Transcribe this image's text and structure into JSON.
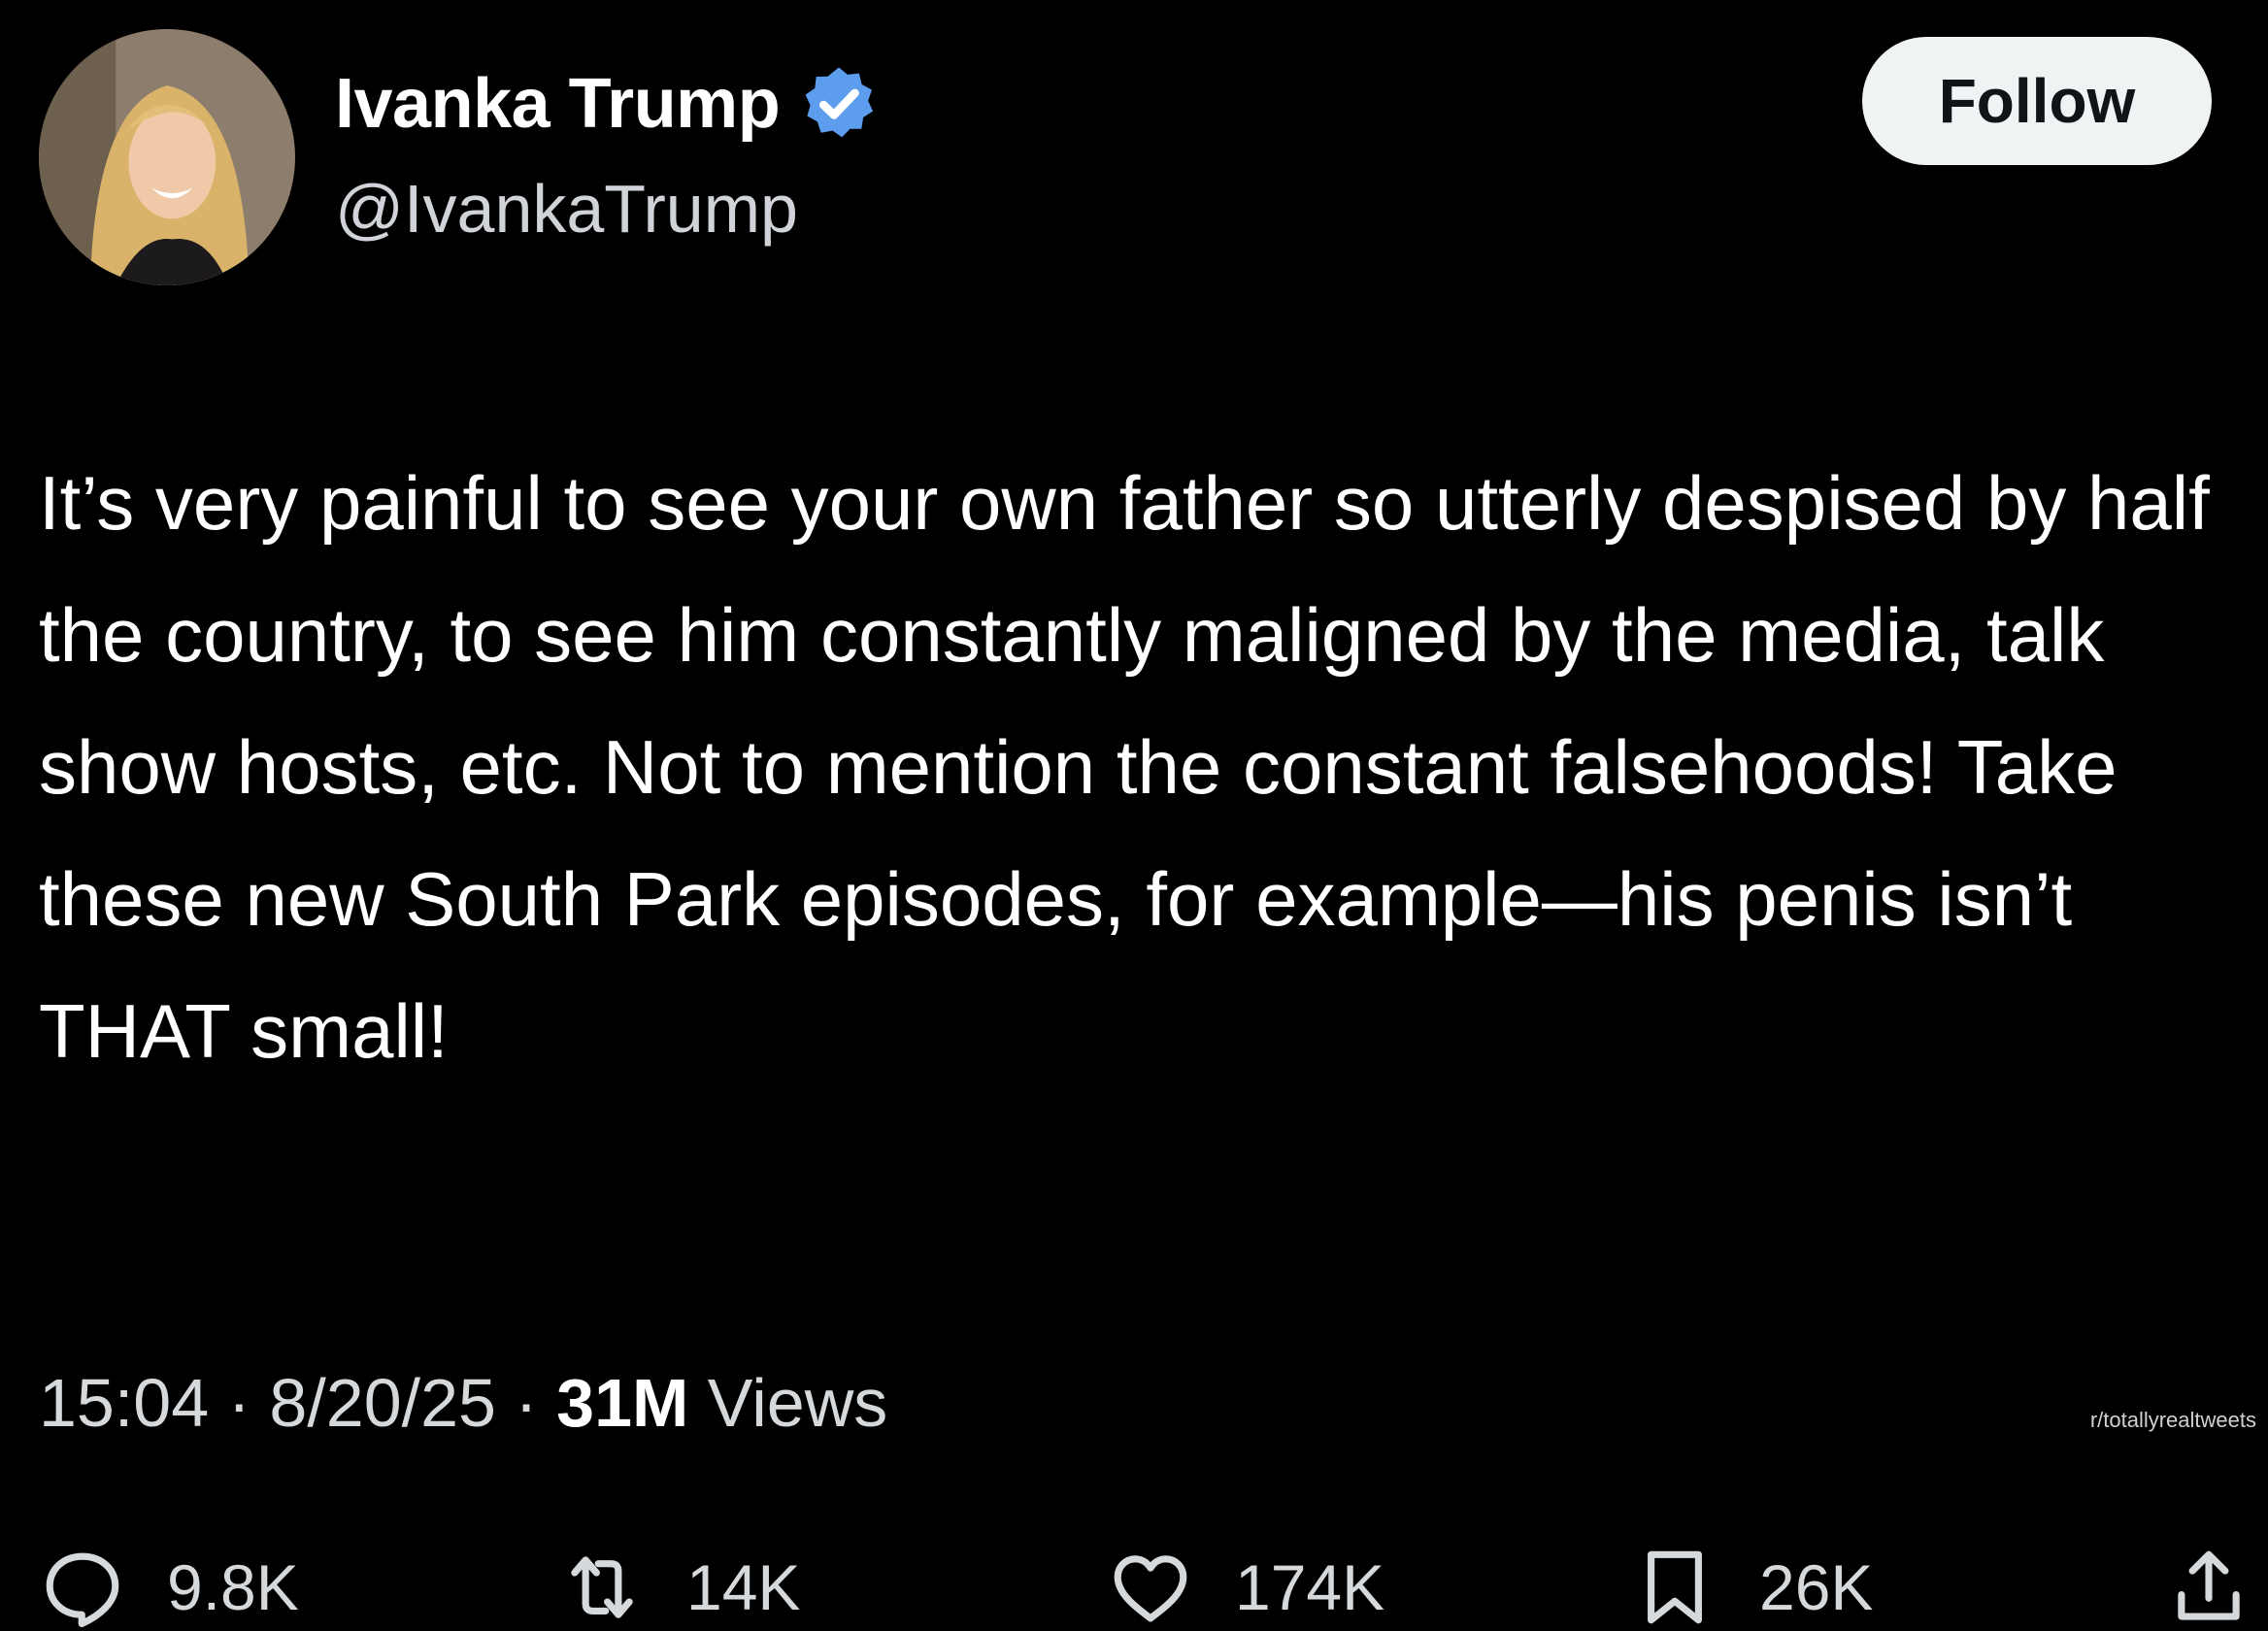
{
  "tweet": {
    "author": {
      "display_name": "Ivanka Trump",
      "handle": "@IvankaTrump",
      "verified": true,
      "verified_color": "#5c9ded"
    },
    "follow_label": "Follow",
    "text": "It’s very painful to see your own father so utterly despised by half the country, to see him constantly maligned by the media, talk show hosts, etc. Not to mention the constant falsehoods! Take these new South Park episodes, for example—his penis isn’t THAT small!",
    "time": "15:04",
    "date": "8/20/25",
    "views_count": "31M",
    "views_label": "Views",
    "separator": " · "
  },
  "watermark": "r/totallyrealtweets",
  "actions": {
    "replies": {
      "icon": "reply-icon",
      "count": "9.8K"
    },
    "reposts": {
      "icon": "repost-icon",
      "count": "14K"
    },
    "likes": {
      "icon": "heart-icon",
      "count": "174K"
    },
    "bookmarks": {
      "icon": "bookmark-icon",
      "count": "26K"
    },
    "share": {
      "icon": "share-icon"
    }
  },
  "colors": {
    "background": "#000000",
    "text": "#ffffff",
    "secondary_text": "#d6d9dc",
    "follow_button_bg": "#eff3f4"
  }
}
